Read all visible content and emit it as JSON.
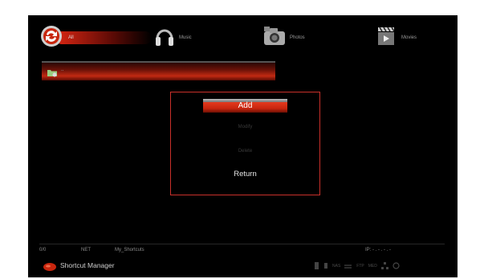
{
  "categories": [
    {
      "label": "All",
      "icon": "all-media-icon",
      "selected": true
    },
    {
      "label": "Music",
      "icon": "headphones-icon",
      "selected": false
    },
    {
      "label": "Photos",
      "icon": "camera-icon",
      "selected": false
    },
    {
      "label": "Movies",
      "icon": "clapperboard-icon",
      "selected": false
    }
  ],
  "path": {
    "text": "..",
    "icon": "folder-icon"
  },
  "menu": {
    "items": [
      "Add",
      "Modify",
      "Delete",
      "Return"
    ],
    "selected": "Add"
  },
  "status": {
    "count": "0/0",
    "source": "NET",
    "folder": "My_Shortcuts",
    "ip": "IP: - . - . - . -"
  },
  "footer": {
    "title": "Shortcut Manager"
  },
  "network_icons": [
    "usb-icon",
    "card-icon",
    "NAS",
    "FTP",
    "MED",
    "network-icon",
    "wifi-icon"
  ],
  "colors": {
    "accent": "#d42a12",
    "frame": "#c8302a",
    "background": "#000000"
  }
}
